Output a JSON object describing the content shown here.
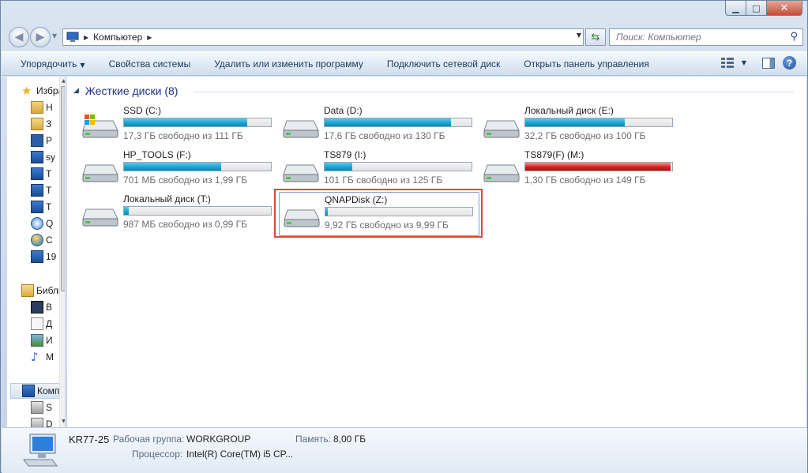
{
  "address": {
    "crumb": "Компьютер"
  },
  "search": {
    "placeholder": "Поиск: Компьютер"
  },
  "commands": [
    "Упорядочить",
    "Свойства системы",
    "Удалить или изменить программу",
    "Подключить сетевой диск",
    "Открыть панель управления"
  ],
  "nav_items": [
    {
      "label": "Избранное",
      "icon": "star-icon"
    },
    {
      "label": "Н",
      "icon": "downloads-icon"
    },
    {
      "label": "З",
      "icon": "folder-icon"
    },
    {
      "label": "Р",
      "icon": "desktop-icon"
    },
    {
      "label": "sy",
      "icon": "network-pc-icon"
    },
    {
      "label": "T",
      "icon": "network-pc-icon"
    },
    {
      "label": "T",
      "icon": "network-pc-icon"
    },
    {
      "label": "T",
      "icon": "network-pc-icon"
    },
    {
      "label": "Q",
      "icon": "sync-icon"
    },
    {
      "label": "C",
      "icon": "globe-icon"
    },
    {
      "label": "19",
      "icon": "network-pc-icon"
    },
    {
      "label": "Библиотеки",
      "icon": "library-icon"
    },
    {
      "label": "В",
      "icon": "video-icon"
    },
    {
      "label": "Д",
      "icon": "document-icon"
    },
    {
      "label": "И",
      "icon": "image-icon"
    },
    {
      "label": "М",
      "icon": "music-icon"
    },
    {
      "label": "Компьютер",
      "icon": "computer-icon"
    },
    {
      "label": "S",
      "icon": "drive-icon"
    },
    {
      "label": "D",
      "icon": "drive-icon"
    }
  ],
  "group": {
    "title": "Жесткие диски (8)"
  },
  "drives": [
    {
      "name": "SSD (C:)",
      "free": "17,3 ГБ свободно из 111 ГБ",
      "used_fraction": 0.84,
      "color": "#1ba5d3",
      "system": true
    },
    {
      "name": "Data (D:)",
      "free": "17,6 ГБ свободно из 130 ГБ",
      "used_fraction": 0.86,
      "color": "#1ba5d3"
    },
    {
      "name": "Локальный диск (E:)",
      "free": "32,2 ГБ свободно из 100 ГБ",
      "used_fraction": 0.68,
      "color": "#1ba5d3"
    },
    {
      "name": "HP_TOOLS (F:)",
      "free": "701 МБ свободно из 1,99 ГБ",
      "used_fraction": 0.66,
      "color": "#1ba5d3"
    },
    {
      "name": "TS879 (I:)",
      "free": "101 ГБ свободно из 125 ГБ",
      "used_fraction": 0.19,
      "color": "#1ba5d3"
    },
    {
      "name": "TS879(F) (M:)",
      "free": "1,30 ГБ свободно из 149 ГБ",
      "used_fraction": 0.99,
      "color": "#d81e1e"
    },
    {
      "name": "Локальный диск (T:)",
      "free": "987 МБ свободно из 0,99 ГБ",
      "used_fraction": 0.03,
      "color": "#1ba5d3"
    },
    {
      "name": "QNAPDisk (Z:)",
      "free": "9,92 ГБ свободно из 9,99 ГБ",
      "used_fraction": 0.01,
      "color": "#1ba5d3",
      "selected": true
    }
  ],
  "details": {
    "computer_name": "KR77-25",
    "workgroup_label": "Рабочая группа:",
    "workgroup_value": "WORKGROUP",
    "memory_label": "Память:",
    "memory_value": "8,00 ГБ",
    "cpu_label": "Процессор:",
    "cpu_value": "Intel(R) Core(TM) i5 CP..."
  }
}
